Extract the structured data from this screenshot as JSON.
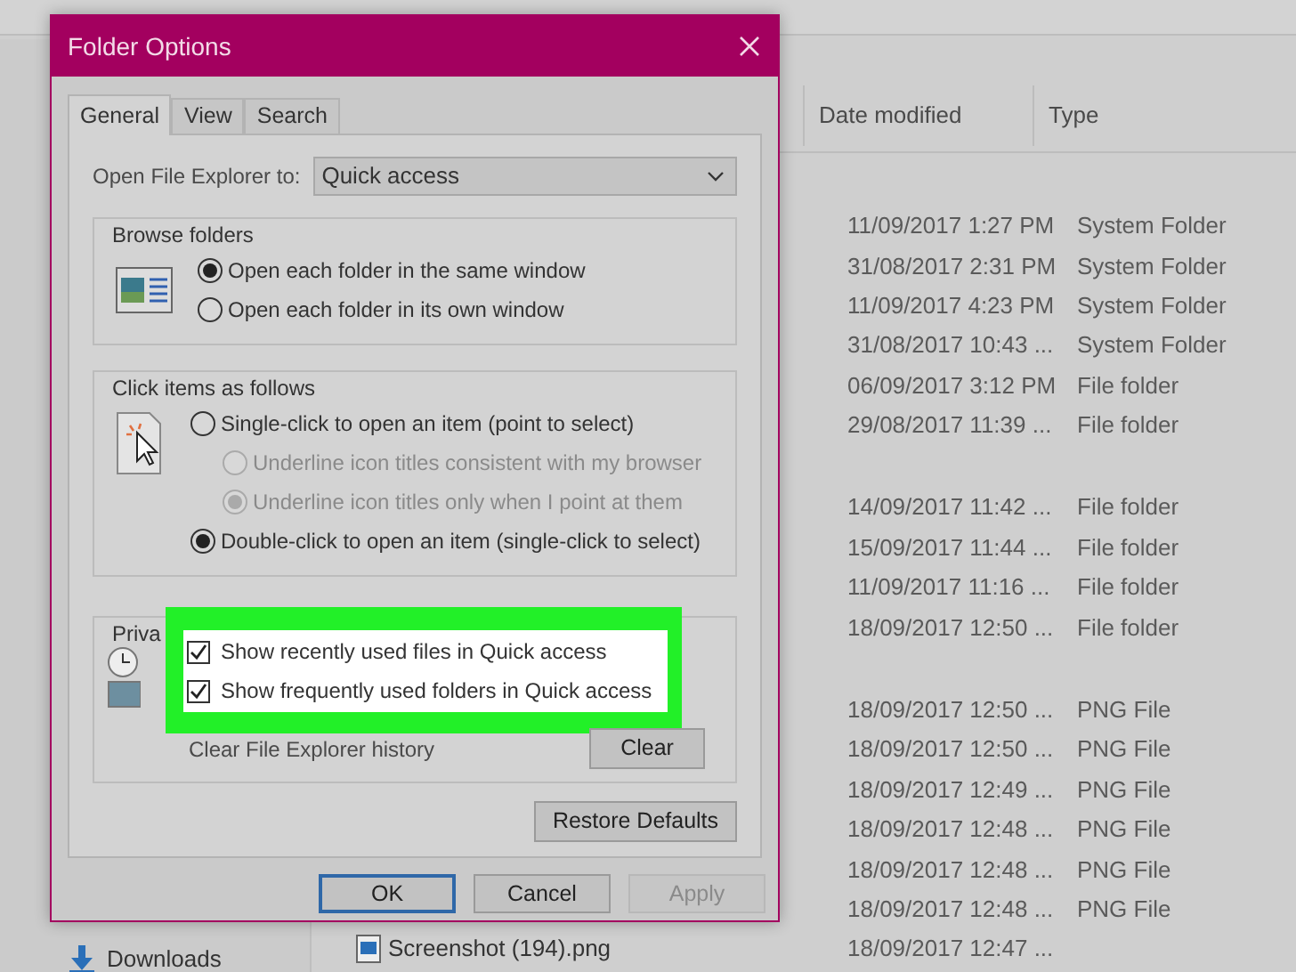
{
  "explorer": {
    "columns": [
      {
        "label": "Date modified"
      },
      {
        "label": "Type"
      }
    ],
    "groups": [
      {
        "rows": [
          {
            "date": "11/09/2017 1:27 PM",
            "type": "System Folder"
          },
          {
            "date": "31/08/2017 2:31 PM",
            "type": "System Folder"
          },
          {
            "date": "11/09/2017 4:23 PM",
            "type": "System Folder"
          },
          {
            "date": "31/08/2017 10:43 ...",
            "type": "System Folder"
          },
          {
            "date": "06/09/2017 3:12 PM",
            "type": "File folder"
          },
          {
            "date": "29/08/2017 11:39 ...",
            "type": "File folder"
          }
        ]
      },
      {
        "rows": [
          {
            "date": "14/09/2017 11:42 ...",
            "type": "File folder"
          },
          {
            "date": "15/09/2017 11:44 ...",
            "type": "File folder"
          },
          {
            "date": "11/09/2017 11:16 ...",
            "type": "File folder"
          },
          {
            "date": "18/09/2017 12:50 ...",
            "type": "File folder"
          }
        ]
      },
      {
        "rows": [
          {
            "date": "18/09/2017 12:50 ...",
            "type": "PNG File"
          },
          {
            "date": "18/09/2017 12:50 ...",
            "type": "PNG File"
          },
          {
            "date": "18/09/2017 12:49 ...",
            "type": "PNG File"
          },
          {
            "date": "18/09/2017 12:48 ...",
            "type": "PNG File"
          },
          {
            "date": "18/09/2017 12:48 ...",
            "type": "PNG File"
          },
          {
            "date": "18/09/2017 12:48 ...",
            "type": "PNG File"
          },
          {
            "name": "Screenshot (194).png",
            "date": "18/09/2017 12:47 ..."
          }
        ]
      }
    ],
    "nav_items": [
      {
        "label": "Downloads"
      }
    ]
  },
  "dialog": {
    "title": "Folder Options",
    "tabs": [
      {
        "label": "General",
        "selected": true
      },
      {
        "label": "View",
        "selected": false
      },
      {
        "label": "Search",
        "selected": false
      }
    ],
    "open_to": {
      "label": "Open File Explorer to:",
      "value": "Quick access"
    },
    "browse": {
      "title": "Browse folders",
      "options": [
        {
          "label": "Open each folder in the same window",
          "selected": true
        },
        {
          "label": "Open each folder in its own window",
          "selected": false
        }
      ]
    },
    "click": {
      "title": "Click items as follows",
      "options": [
        {
          "label": "Single-click to open an item (point to select)",
          "selected": false,
          "disabled": false,
          "children": [
            {
              "label": "Underline icon titles consistent with my browser",
              "selected": false,
              "disabled": true
            },
            {
              "label": "Underline icon titles only when I point at them",
              "selected": true,
              "disabled": true
            }
          ]
        },
        {
          "label": "Double-click to open an item (single-click to select)",
          "selected": true,
          "disabled": false
        }
      ]
    },
    "privacy": {
      "title": "Priva",
      "highlighted": true,
      "options": [
        {
          "label": "Show recently used files in Quick access",
          "checked": true
        },
        {
          "label": "Show frequently used folders in Quick access",
          "checked": true
        }
      ],
      "clear_label": "Clear File Explorer history",
      "clear_button": "Clear"
    },
    "restore_button": "Restore Defaults",
    "buttons": [
      {
        "label": "OK",
        "default": true,
        "disabled": false
      },
      {
        "label": "Cancel",
        "default": false,
        "disabled": false
      },
      {
        "label": "Apply",
        "default": false,
        "disabled": true
      }
    ]
  }
}
